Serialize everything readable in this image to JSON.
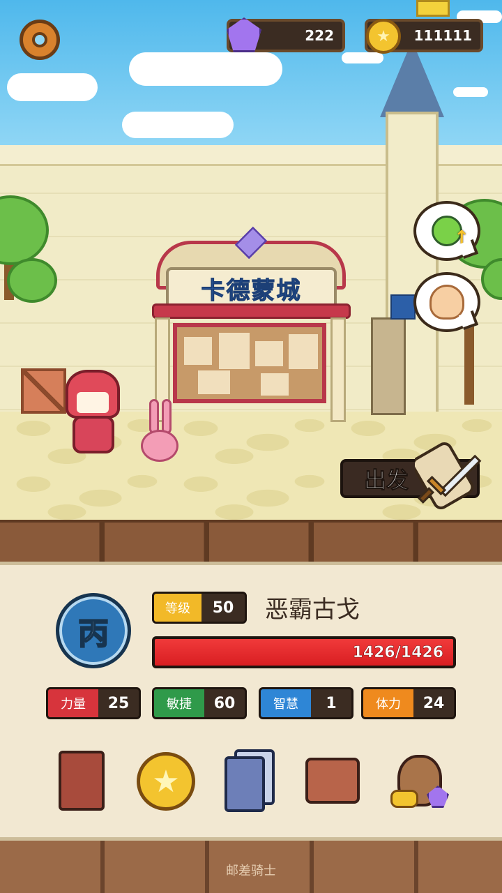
{
  "resources": {
    "gems": "222",
    "gold": "111111"
  },
  "location": {
    "gate_sign": "卡德蒙城"
  },
  "actions": {
    "depart_label": "出发"
  },
  "character": {
    "rank_glyph": "丙",
    "level_label": "等级",
    "level_value": "50",
    "name": "恶霸古戈",
    "hp_text": "1426/1426",
    "hp_fraction": 1.0
  },
  "stats": [
    {
      "label": "力量",
      "value": "25",
      "color": "#d7343c"
    },
    {
      "label": "敏捷",
      "value": "60",
      "color": "#2f9a4a"
    },
    {
      "label": "智慧",
      "value": "1",
      "color": "#2e86d6"
    },
    {
      "label": "体力",
      "value": "24",
      "color": "#ef8a1e"
    }
  ],
  "menu": [
    {
      "icon": "book-icon"
    },
    {
      "icon": "gold-coin-icon"
    },
    {
      "icon": "cards-icon"
    },
    {
      "icon": "backpack-icon"
    },
    {
      "icon": "treasure-sack-icon"
    }
  ],
  "footer": {
    "title": "邮差骑士"
  },
  "colors": {
    "sky": "#5ec4ee",
    "panel": "#f2e8d2",
    "hp_red": "#e02a2e",
    "level_gold": "#f2b928"
  }
}
